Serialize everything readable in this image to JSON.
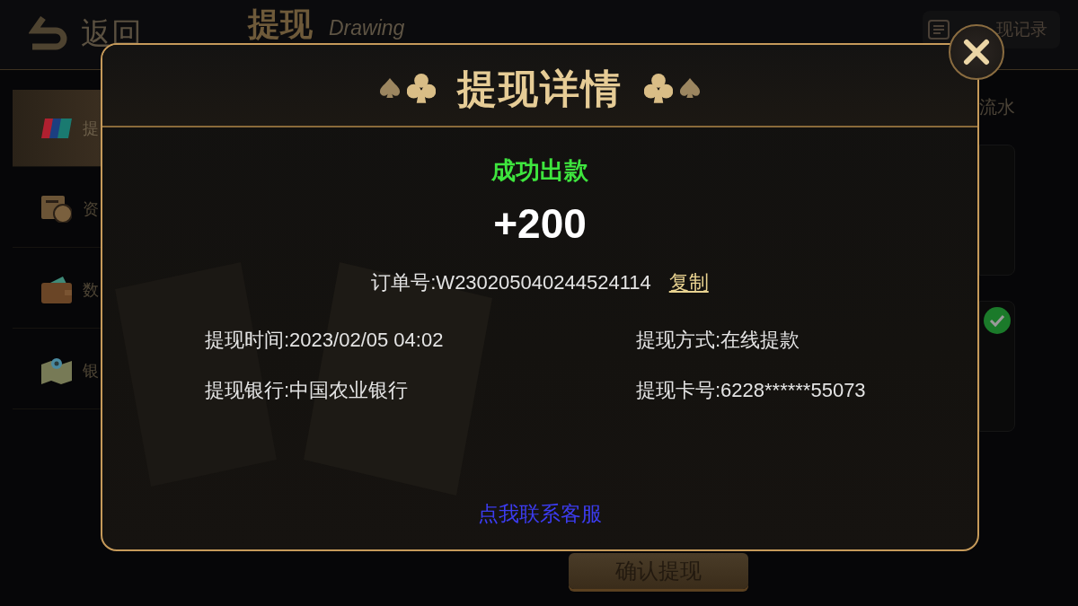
{
  "header": {
    "back_label": "返回",
    "title": "提现",
    "subtitle": "Drawing",
    "record_label": "现记录"
  },
  "sidebar": {
    "items": [
      {
        "kind": "unionpay",
        "label": "提",
        "selected": true
      },
      {
        "kind": "coin",
        "label": "资",
        "selected": false
      },
      {
        "kind": "wallet",
        "label": "数",
        "selected": false
      },
      {
        "kind": "map",
        "label": "银",
        "selected": false
      }
    ]
  },
  "right_panel": {
    "label": "流水",
    "cards": [
      {
        "checked": false
      },
      {
        "checked": true
      }
    ]
  },
  "confirm_button": "确认提现",
  "dialog": {
    "title": "提现详情",
    "status": "成功出款",
    "amount": "+200",
    "order_number": "订单号:W230205040244524114",
    "copy_label": "复制",
    "details": [
      "提现时间:2023/02/05 04:02",
      "提现方式:在线提款",
      "提现银行:中国农业银行",
      "提现卡号:6228******55073"
    ],
    "contact_link": "点我联系客服"
  }
}
